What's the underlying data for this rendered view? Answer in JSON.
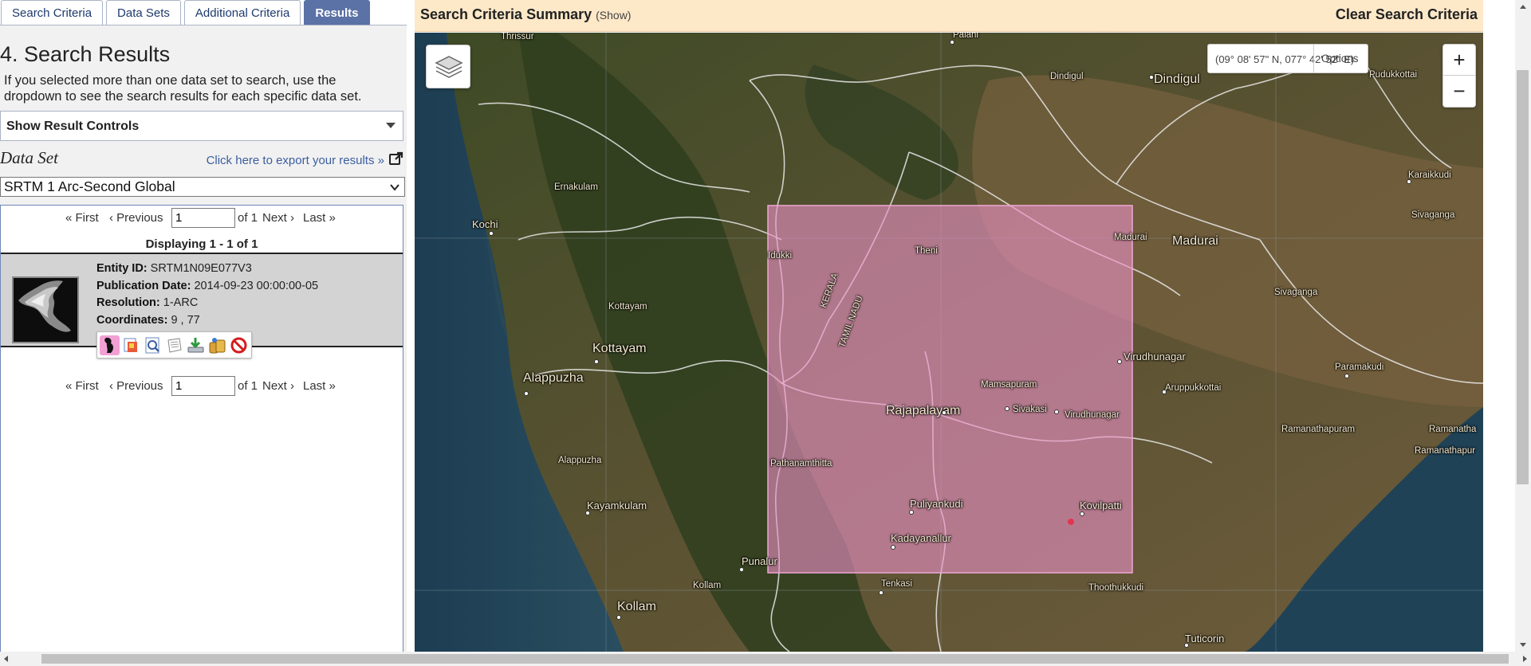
{
  "tabs": [
    {
      "label": "Search Criteria",
      "active": false
    },
    {
      "label": "Data Sets",
      "active": false
    },
    {
      "label": "Additional Criteria",
      "active": false
    },
    {
      "label": "Results",
      "active": true
    }
  ],
  "results_panel": {
    "title": "4. Search Results",
    "intro": "If you selected more than one data set to search, use the dropdown to see the search results for each specific data set.",
    "controls_label": "Show Result Controls",
    "dataset_label": "Data Set",
    "export_link": "Click here to export your results »",
    "dataset_selected": "SRTM 1 Arc-Second Global",
    "pager": {
      "first": "« First",
      "previous": "‹ Previous",
      "page_value": "1",
      "of": "of 1",
      "next": "Next ›",
      "last": "Last »"
    },
    "displaying": "Displaying 1 - 1 of 1",
    "result": {
      "entity_id_label": "Entity ID:",
      "entity_id": "SRTM1N09E077V3",
      "publication_date_label": "Publication Date:",
      "publication_date": "2014-09-23 00:00:00-05",
      "resolution_label": "Resolution:",
      "resolution": "1-ARC",
      "coordinates_label": "Coordinates:",
      "coordinates": "9 , 77",
      "actions": [
        "footprint-icon",
        "browse-overlay-icon",
        "compare-icon",
        "metadata-icon",
        "download-icon",
        "bulk-download-icon",
        "exclude-icon"
      ]
    }
  },
  "map": {
    "summary_title": "Search Criteria Summary",
    "summary_show": "(Show)",
    "clear_label": "Clear Search Criteria",
    "coords_readout": "(09° 08' 57\" N, 077° 42' 52\" E)",
    "options_label": "Options",
    "zoom_in": "+",
    "zoom_out": "−",
    "labels": {
      "thrissur": "Thrissur",
      "palani": "Palani",
      "dindigul_small": "Dindigul",
      "dindigul": "Dindigul",
      "pudukkottai": "Pudukkottai",
      "pud2": "Pu",
      "ernakulam": "Ernakulam",
      "kochi": "Kochi",
      "karaikkudi": "Karaikkudi",
      "sivaganga": "Sivaganga",
      "idukki": "Idukki",
      "theni": "Theni",
      "madurai_small": "Madurai",
      "madurai": "Madurai",
      "sivagangai": "Sivaganga",
      "kottayam_small": "Kottayam",
      "kottayam": "Kottayam",
      "kerala": "KERALA",
      "tamilnadu": "TAMIL NADU",
      "virudhunagar": "Virudhunagar",
      "paramakudi": "Paramakudi",
      "alappuzha": "Alappuzha",
      "mamsapuram": "Mamsapuram",
      "aruppukkottai": "Aruppukkottai",
      "rajapalayam": "Rajapalayam",
      "sivakasi": "Sivakasi",
      "virudhunagar_small": "Virudhunagar",
      "ramanathapuram": "Ramanathapuram",
      "ramanatha": "Ramanatha",
      "ramanathapur": "Ramanathapur",
      "alappuzha_small": "Alappuzha",
      "pathanamthitta": "Pathanamthitta",
      "kayamkulam": "Kayamkulam",
      "puliyankudi": "Puliyankudi",
      "kovilpatti": "Kovilpatti",
      "kadayanallur": "Kadayanallur",
      "punalur": "Punalur",
      "kollam_small": "Kollam",
      "tenkasi": "Tenkasi",
      "thoothukkudi": "Thoothukkudi",
      "kollam": "Kollam",
      "tuticorin": "Tuticorin"
    },
    "footprint_color": "#e88fc4"
  }
}
